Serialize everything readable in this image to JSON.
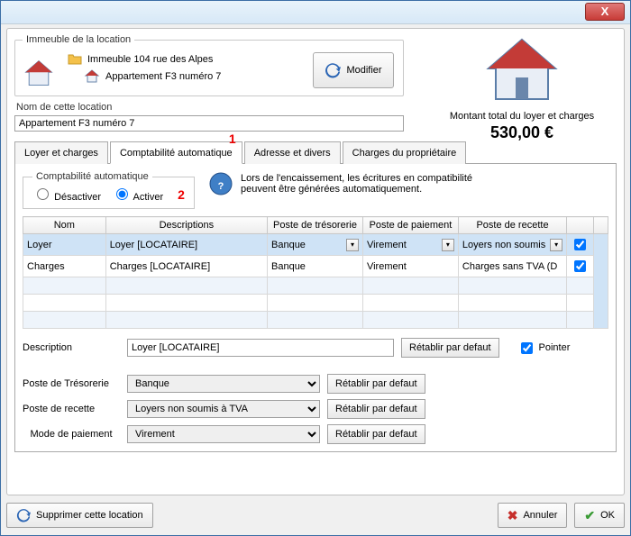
{
  "titlebar": {
    "close": "X"
  },
  "location": {
    "legend": "Immeuble de la location",
    "building": "Immeuble 104 rue des Alpes",
    "apartment": "Appartement F3 numéro 7",
    "modify": "Modifier"
  },
  "name": {
    "label": "Nom de cette location",
    "value": "Appartement F3 numéro 7"
  },
  "total": {
    "label": "Montant total du loyer et charges",
    "amount": "530,00 €"
  },
  "tabs": {
    "t1": "Loyer et charges",
    "t2": "Comptabilité automatique",
    "t3": "Adresse et divers",
    "t4": "Charges du propriétaire"
  },
  "annot": {
    "one": "1",
    "two": "2"
  },
  "auto": {
    "legend": "Comptabilité automatique",
    "off": "Désactiver",
    "on": "Activer",
    "help": "Lors de l'encaissement, les écritures en compatibilité peuvent être générées automatiquement."
  },
  "grid": {
    "headers": {
      "nom": "Nom",
      "desc": "Descriptions",
      "tres": "Poste de trésorerie",
      "pai": "Poste de paiement",
      "rec": "Poste de recette"
    },
    "rows": [
      {
        "nom": "Loyer",
        "desc": "Loyer [LOCATAIRE]",
        "tres": "Banque",
        "pai": "Virement",
        "rec": "Loyers non soumis",
        "checked": true
      },
      {
        "nom": "Charges",
        "desc": "Charges [LOCATAIRE]",
        "tres": "Banque",
        "pai": "Virement",
        "rec": "Charges sans TVA (D",
        "checked": true
      }
    ]
  },
  "form": {
    "description_label": "Description",
    "description_value": "Loyer [LOCATAIRE]",
    "reset": "Rétablir par defaut",
    "pointer": "Pointer",
    "tres_label": "Poste de Trésorerie",
    "tres_value": "Banque",
    "rec_label": "Poste de recette",
    "rec_value": "Loyers non soumis à TVA",
    "mode_label": "Mode de paiement",
    "mode_value": "Virement"
  },
  "bottom": {
    "delete": "Supprimer cette location",
    "cancel": "Annuler",
    "ok": "OK"
  }
}
